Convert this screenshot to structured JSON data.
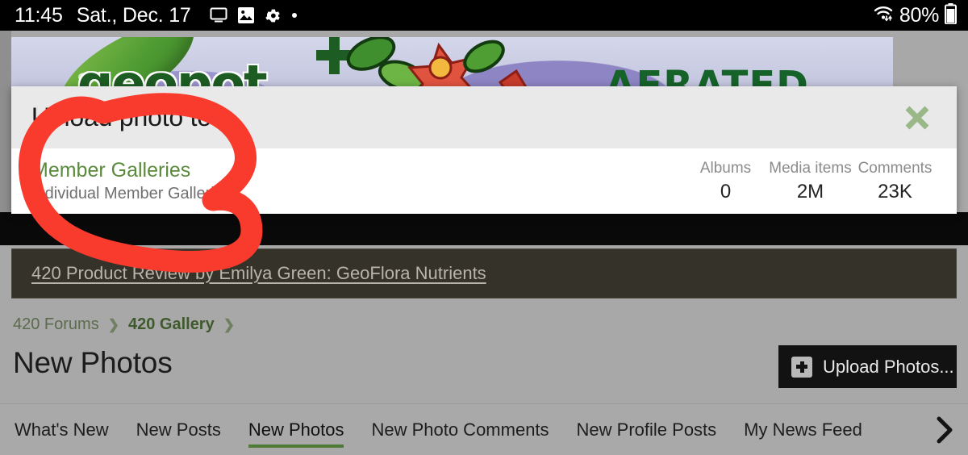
{
  "status_bar": {
    "time": "11:45",
    "date": "Sat., Dec. 17",
    "icons": [
      "cast-screen-icon",
      "photo-icon",
      "gear-icon",
      "dot-icon"
    ],
    "wifi_icon": "wifi-icon",
    "battery_percent": "80%",
    "battery_icon": "battery-icon"
  },
  "banner_ad": {
    "brand_text": "geopot",
    "tagline": "AERATED"
  },
  "modal": {
    "title": "Upload photo to...",
    "close_icon": "close-icon",
    "close_color": "#9ab887",
    "row": {
      "title": "Member Galleries",
      "subtitle": "Individual Member Galleries",
      "title_color": "#5a8a3c",
      "stats": [
        {
          "label": "Albums",
          "value": "0"
        },
        {
          "label": "Media items",
          "value": "2M"
        },
        {
          "label": "Comments",
          "value": "23K"
        }
      ]
    }
  },
  "notice": {
    "link_text": "420 Product Review by Emilya Green: GeoFlora Nutrients"
  },
  "breadcrumb": {
    "items": [
      {
        "label": "420 Forums",
        "bold": false
      },
      {
        "label": "420 Gallery",
        "bold": true
      }
    ],
    "separator_icon": "chevron-right-icon"
  },
  "page": {
    "title": "New Photos",
    "upload_button": {
      "label": "Upload Photos...",
      "icon": "plus-square-icon"
    }
  },
  "tabs": {
    "items": [
      {
        "label": "What's New",
        "active": false
      },
      {
        "label": "New Posts",
        "active": false
      },
      {
        "label": "New Photos",
        "active": true
      },
      {
        "label": "New Photo Comments",
        "active": false
      },
      {
        "label": "New Profile Posts",
        "active": false
      },
      {
        "label": "My News Feed",
        "active": false
      }
    ],
    "overflow_icon": "chevron-right-icon",
    "active_underline_color": "#4e7c36"
  },
  "annotation": {
    "shape": "hand-drawn-circle",
    "color": "#f93b2e",
    "target": "Member Galleries"
  }
}
